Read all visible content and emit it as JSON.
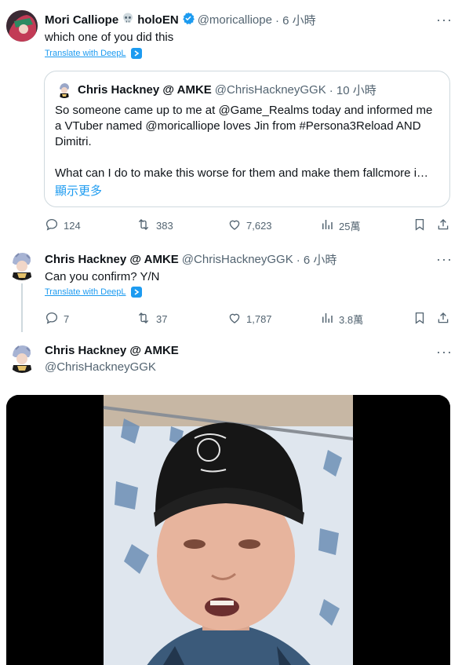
{
  "tweet1": {
    "name": "Mori Calliope",
    "name_suffix": "holoEN",
    "handle": "@moricalliope",
    "time": "· 6 小時",
    "text": "which one of you did this",
    "translate": "Translate with DeepL",
    "quote": {
      "name": "Chris Hackney @ AMKE",
      "handle": "@ChrisHackneyGGK",
      "time": "· 10 小時",
      "para1": "So someone came up to me at @Game_Realms today and informed me a VTuber named @moricalliope loves Jin from #Persona3Reload AND Dimitri.",
      "para2": "What can I do to make this worse for them and make them fallcmore i…",
      "show_more": "顯示更多"
    },
    "actions": {
      "replies": "124",
      "reposts": "383",
      "likes": "7,623",
      "views": "25萬"
    }
  },
  "tweet2": {
    "name": "Chris Hackney @ AMKE",
    "handle": "@ChrisHackneyGGK",
    "time": "· 6 小時",
    "text": "Can you confirm? Y/N",
    "translate": "Translate with DeepL",
    "actions": {
      "replies": "7",
      "reposts": "37",
      "likes": "1,787",
      "views": "3.8萬"
    }
  },
  "tweet3": {
    "name": "Chris Hackney @ AMKE",
    "handle": "@ChrisHackneyGGK"
  },
  "colors": {
    "accent": "#1d9bf0",
    "secondary_text": "#536471",
    "primary_text": "#0f1419",
    "border": "#cfd9de"
  }
}
